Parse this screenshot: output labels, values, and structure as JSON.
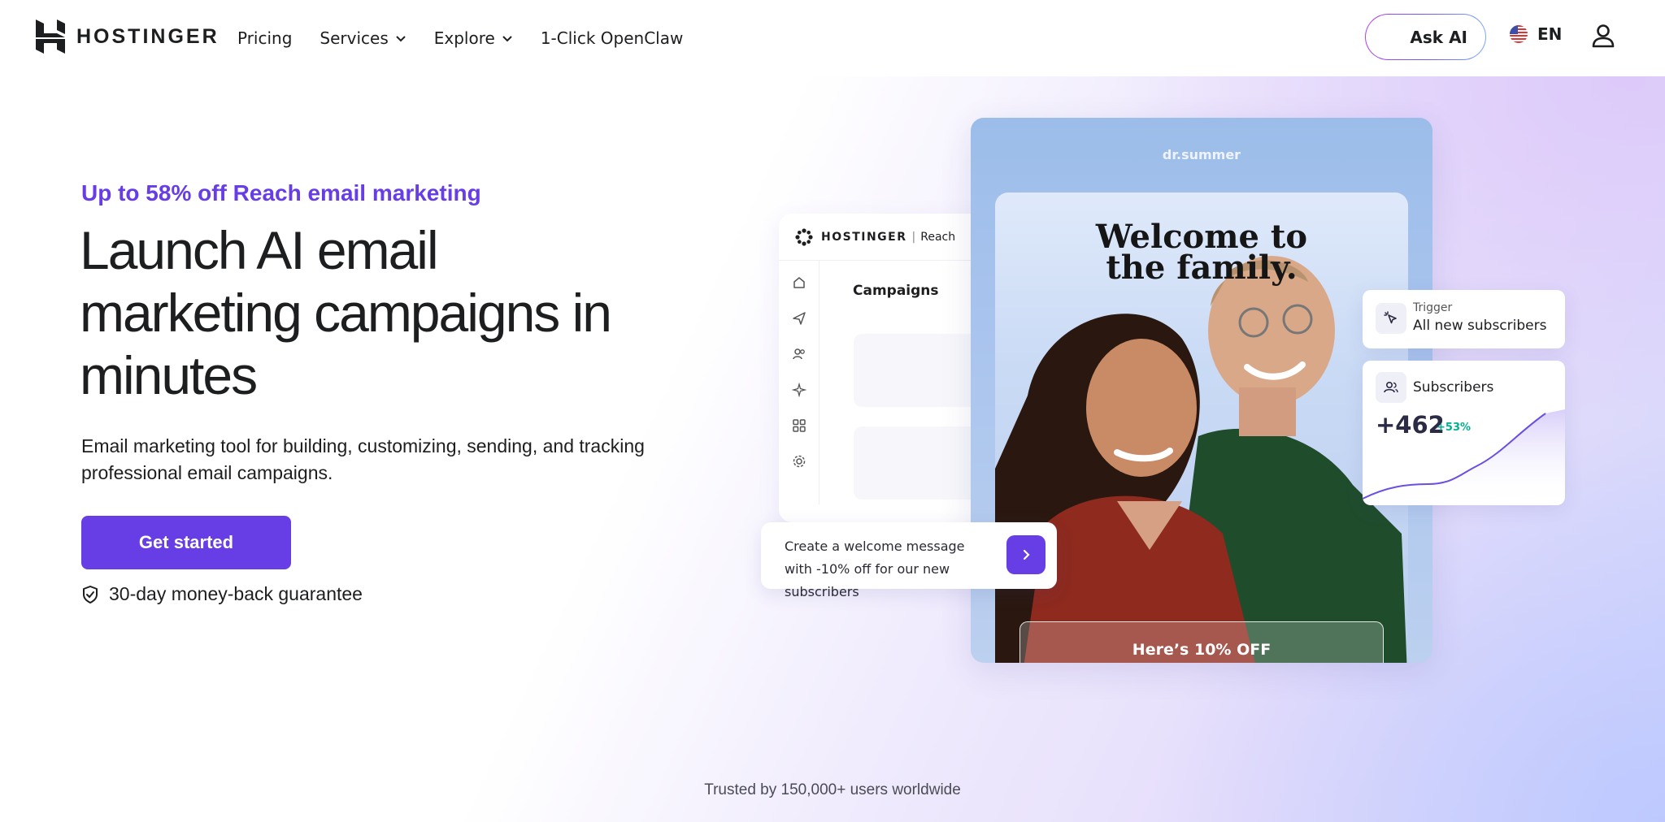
{
  "header": {
    "logo_text": "HOSTINGER",
    "nav": [
      {
        "label": "Pricing",
        "has_dropdown": false
      },
      {
        "label": "Services",
        "has_dropdown": true
      },
      {
        "label": "Explore",
        "has_dropdown": true
      },
      {
        "label": "1-Click OpenClaw",
        "has_dropdown": false
      }
    ],
    "ask_ai_label": "Ask AI",
    "language": "EN"
  },
  "hero": {
    "promo": "Up to 58% off Reach email marketing",
    "headline": "Launch AI email marketing campaigns in minutes",
    "subtitle": "Email marketing tool for building, customizing, sending, and tracking professional email campaigns.",
    "cta_label": "Get started",
    "guarantee": "30-day money-back guarantee"
  },
  "mockup": {
    "app": {
      "brand": "HOSTINGER",
      "product": "Reach",
      "section_title": "Campaigns",
      "sidebar_icons": [
        "home-icon",
        "send-icon",
        "users-icon",
        "sparkle-icon",
        "apps-icon",
        "settings-icon"
      ]
    },
    "email": {
      "sender": "dr.summer",
      "title": "Welcome to the family.",
      "offer_button": "Here’s 10% OFF"
    },
    "prompt": {
      "text": "Create a welcome message with -10% off for our new subscribers"
    },
    "trigger": {
      "label": "Trigger",
      "value": "All new subscribers"
    },
    "subscribers": {
      "label": "Subscribers",
      "count": "+462",
      "change": "+53%"
    }
  },
  "footer": {
    "trusted": "Trusted by 150,000+ users worldwide"
  },
  "colors": {
    "brand_purple": "#673de6",
    "text_dark": "#1d1e20",
    "positive_green": "#00b090"
  }
}
